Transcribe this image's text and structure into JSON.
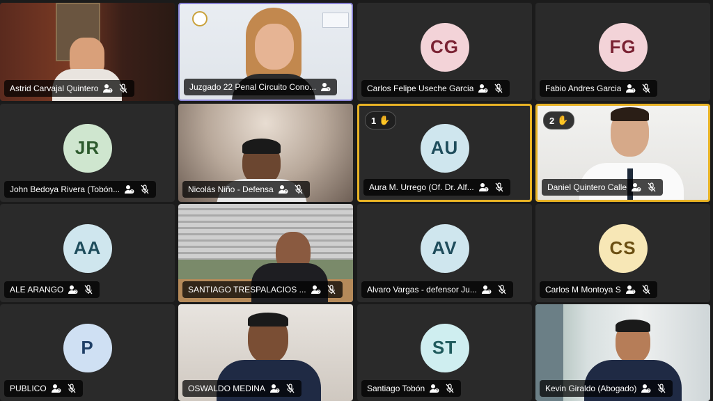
{
  "participants": [
    {
      "name": "Astrid Carvajal Quintero",
      "type": "video"
    },
    {
      "name": "Juzgado 22 Penal Circuito Cono...",
      "type": "video"
    },
    {
      "name": "Carlos Felipe Useche Garcia",
      "initials": "CG",
      "type": "avatar",
      "avatar_bg": "#f3d3d8",
      "avatar_fg": "#7a2233"
    },
    {
      "name": "Fabio Andres Garcia",
      "initials": "FG",
      "type": "avatar",
      "avatar_bg": "#f3d3d8",
      "avatar_fg": "#7a2233"
    },
    {
      "name": "John Bedoya Rivera (Tobón...",
      "initials": "JR",
      "type": "avatar",
      "avatar_bg": "#cfe6cf",
      "avatar_fg": "#2d5a2d"
    },
    {
      "name": "Nicolás Niño - Defensa",
      "type": "video"
    },
    {
      "name": "Aura M. Urrego (Of. Dr. Alf...",
      "initials": "AU",
      "type": "avatar",
      "avatar_bg": "#cfe6ee",
      "avatar_fg": "#1f4d5c",
      "hand": "1"
    },
    {
      "name": "Daniel Quintero Calle",
      "type": "video",
      "hand": "2"
    },
    {
      "name": "ALE ARANGO",
      "initials": "AA",
      "type": "avatar",
      "avatar_bg": "#cfe6ee",
      "avatar_fg": "#1f4d5c"
    },
    {
      "name": "SANTIAGO TRESPALACIOS ...",
      "type": "video"
    },
    {
      "name": "Alvaro Vargas - defensor Ju...",
      "initials": "AV",
      "type": "avatar",
      "avatar_bg": "#cfe6ee",
      "avatar_fg": "#1f4d5c"
    },
    {
      "name": "Carlos M Montoya S",
      "initials": "CS",
      "type": "avatar",
      "avatar_bg": "#f7e7b6",
      "avatar_fg": "#6b4f12"
    },
    {
      "name": "PUBLICO",
      "initials": "P",
      "type": "avatar",
      "avatar_bg": "#cfe0f3",
      "avatar_fg": "#1f3f66"
    },
    {
      "name": "OSWALDO MEDINA",
      "type": "video"
    },
    {
      "name": "Santiago Tobón",
      "initials": "ST",
      "type": "avatar",
      "avatar_bg": "#cfeef0",
      "avatar_fg": "#1f5a5c"
    },
    {
      "name": "Kevin Giraldo (Abogado)",
      "type": "video"
    }
  ],
  "icons": {
    "muted": "mic-off-icon",
    "unverified": "unverified-user-icon",
    "hand": "raised-hand-icon"
  },
  "colors": {
    "active_speaker_border": "#8a84d6",
    "raised_hand_border": "#e8b325",
    "tile_bg": "#2a2a2a"
  }
}
